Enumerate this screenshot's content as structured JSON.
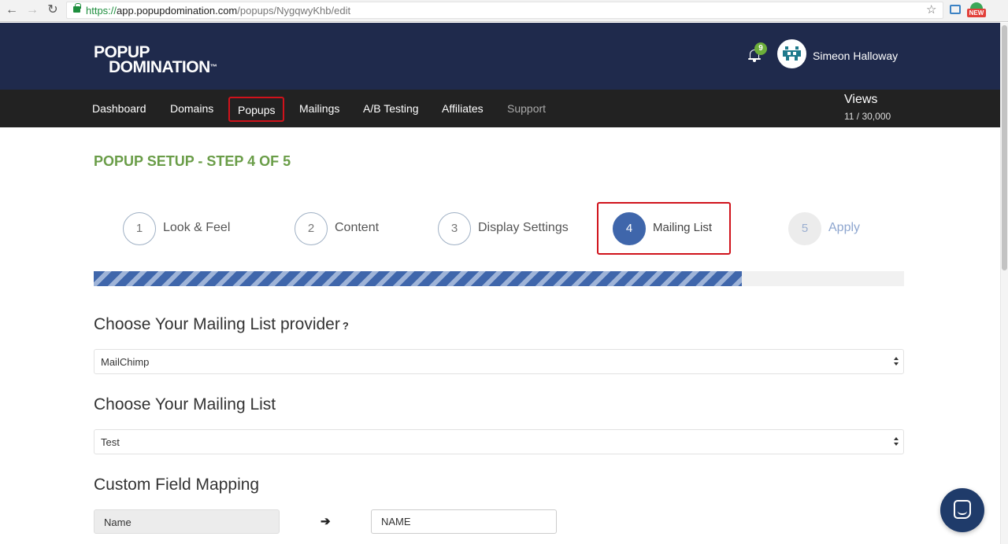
{
  "browser": {
    "url_protocol": "https://",
    "url_host": "app.popupdomination.com",
    "url_path": "/popups/NygqwyKhb/edit",
    "ext_badge": "NEW"
  },
  "header": {
    "logo_line1": "POPUP",
    "logo_line2": "DOMINATION",
    "logo_tm": "™",
    "notification_count": "9",
    "user_name": "Simeon Halloway"
  },
  "nav": {
    "items": [
      "Dashboard",
      "Domains",
      "Popups",
      "Mailings",
      "A/B Testing",
      "Affiliates",
      "Support"
    ],
    "active": "Popups",
    "views_label": "Views",
    "views_value": "11 / 30,000"
  },
  "page": {
    "title": "POPUP SETUP - STEP 4 OF 5",
    "steps": [
      {
        "number": "1",
        "label": "Look & Feel",
        "state": "completed"
      },
      {
        "number": "2",
        "label": "Content",
        "state": "completed"
      },
      {
        "number": "3",
        "label": "Display Settings",
        "state": "completed"
      },
      {
        "number": "4",
        "label": "Mailing List",
        "state": "active"
      },
      {
        "number": "5",
        "label": "Apply",
        "state": "disabled"
      }
    ],
    "progress_fraction": 0.8,
    "provider_heading": "Choose Your Mailing List provider",
    "provider_help": "?",
    "provider_value": "MailChimp",
    "list_heading": "Choose Your Mailing List",
    "list_value": "Test",
    "mapping_heading": "Custom Field Mapping",
    "mapping_source": "Name",
    "mapping_arrow": "➔",
    "mapping_target": "NAME"
  },
  "colors": {
    "header_bg": "#1f2a4c",
    "nav_bg": "#222222",
    "step_title": "#6a9d48",
    "active_step": "#3f66ab",
    "highlight": "#d0121b"
  },
  "icons": {
    "back": "←",
    "forward": "→",
    "reload": "↻",
    "star": "☆"
  }
}
